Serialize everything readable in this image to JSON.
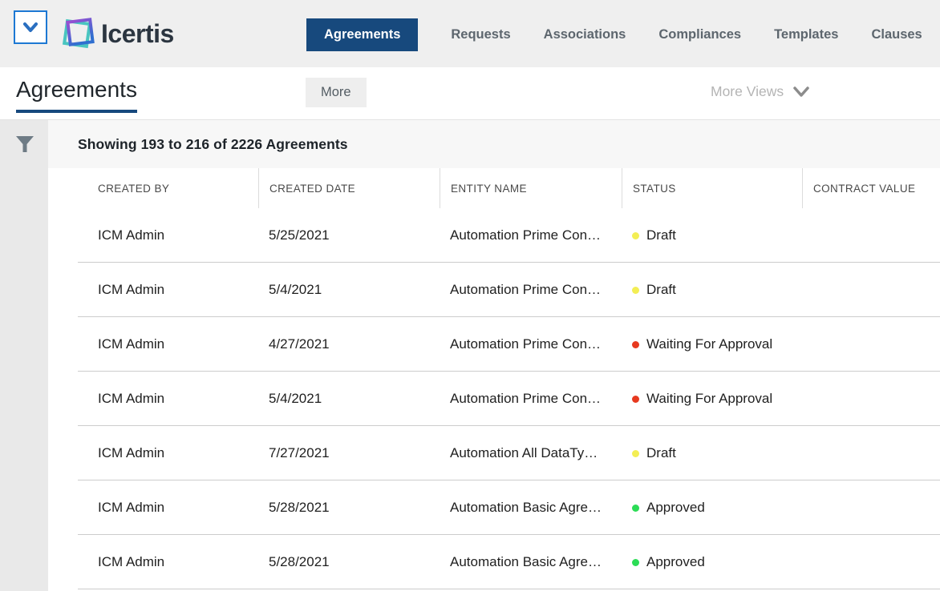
{
  "brand": {
    "name": "Icertis"
  },
  "topnav": {
    "items": [
      {
        "label": "Agreements",
        "active": true
      },
      {
        "label": "Requests",
        "active": false
      },
      {
        "label": "Associations",
        "active": false
      },
      {
        "label": "Compliances",
        "active": false
      },
      {
        "label": "Templates",
        "active": false
      },
      {
        "label": "Clauses",
        "active": false
      }
    ]
  },
  "header": {
    "title": "Agreements",
    "more_label": "More",
    "more_views_label": "More Views"
  },
  "table": {
    "summary": "Showing 193 to 216 of 2226 Agreements",
    "columns": [
      "CREATED BY",
      "CREATED DATE",
      "ENTITY NAME",
      "STATUS",
      "CONTRACT VALUE"
    ],
    "rows": [
      {
        "created_by": "ICM Admin",
        "created_date": "5/25/2021",
        "entity_name": "Automation Prime Con…",
        "status": "Draft",
        "contract_value": ""
      },
      {
        "created_by": "ICM Admin",
        "created_date": "5/4/2021",
        "entity_name": "Automation Prime Con…",
        "status": "Draft",
        "contract_value": ""
      },
      {
        "created_by": "ICM Admin",
        "created_date": "4/27/2021",
        "entity_name": "Automation Prime Con…",
        "status": "Waiting For Approval",
        "contract_value": ""
      },
      {
        "created_by": "ICM Admin",
        "created_date": "5/4/2021",
        "entity_name": "Automation Prime Con…",
        "status": "Waiting For Approval",
        "contract_value": ""
      },
      {
        "created_by": "ICM Admin",
        "created_date": "7/27/2021",
        "entity_name": "Automation All DataTy…",
        "status": "Draft",
        "contract_value": ""
      },
      {
        "created_by": "ICM Admin",
        "created_date": "5/28/2021",
        "entity_name": "Automation Basic Agre…",
        "status": "Approved",
        "contract_value": ""
      },
      {
        "created_by": "ICM Admin",
        "created_date": "5/28/2021",
        "entity_name": "Automation Basic Agre…",
        "status": "Approved",
        "contract_value": ""
      }
    ]
  },
  "status_colors": {
    "Draft": "#f3ee54",
    "Waiting For Approval": "#e7391f",
    "Approved": "#2cdc56"
  },
  "colors": {
    "accent_navy": "#17497d",
    "button_blue": "#1d78d3",
    "topbar_bg": "#efefef",
    "sidebar_bg": "#e9e9e9",
    "band_bg": "#f7f7f7"
  }
}
